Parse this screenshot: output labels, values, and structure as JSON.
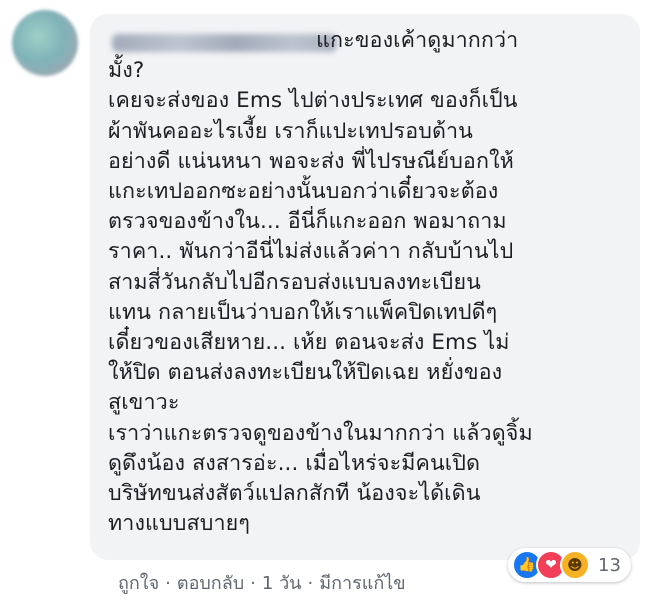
{
  "comment": {
    "text_lines": [
      "                              แกะของเค้าดูมากกว่า",
      "มั้ง?",
      "เคยจะส่งของ Ems ไปต่างประเทศ ของก็เป็น",
      "ผ้าพันคออะไรเงี้ย เราก็แปะเทปรอบด้าน",
      "อย่างดี แน่นหนา พอจะส่ง พี่ไปรษณีย์บอกให้",
      "แกะเทปออกซะอย่างนั้นบอกว่าเดี๋ยวจะต้อง",
      "ตรวจของข้างใน... อีนี่ก็แกะออก พอมาถาม",
      "ราคา.. พันกว่าอีนี่ไม่ส่งแล้วค่าา กลับบ้านไป",
      "สามสี่วันกลับไปอีกรอบส่งแบบลงทะเบียน",
      "แทน กลายเป็นว่าบอกให้เราแพ็คปิดเทปดีๆ",
      "เดี๋ยวของเสียหาย... เห้ย ตอนจะส่ง Ems ไม่",
      "ให้ปิด ตอนส่งลงทะเบียนให้ปิดเฉย หยั่งของ",
      "สูเขาวะ",
      "เราว่าแกะตรวจดูของข้างในมากกว่า แล้วดูจิ้ม",
      "ดูดึงน้อง สงสารอ่ะ... เมื่อไหร่จะมีคนเปิด",
      "บริษัทขนส่งสัตว์แปลกสักที น้องจะได้เดิน",
      "ทางแบบสบายๆ"
    ]
  },
  "footer": {
    "like": "ถูกใจ",
    "reply": "ตอบกลับ",
    "time": "1 วัน",
    "edited": "มีการแก้ไข",
    "sep": "·"
  },
  "reactions": {
    "count": "13",
    "icons": [
      "like-icon",
      "love-icon",
      "haha-icon"
    ],
    "colors": {
      "like": "#1877f2",
      "love": "#f33e58",
      "haha": "#f7b125"
    }
  }
}
